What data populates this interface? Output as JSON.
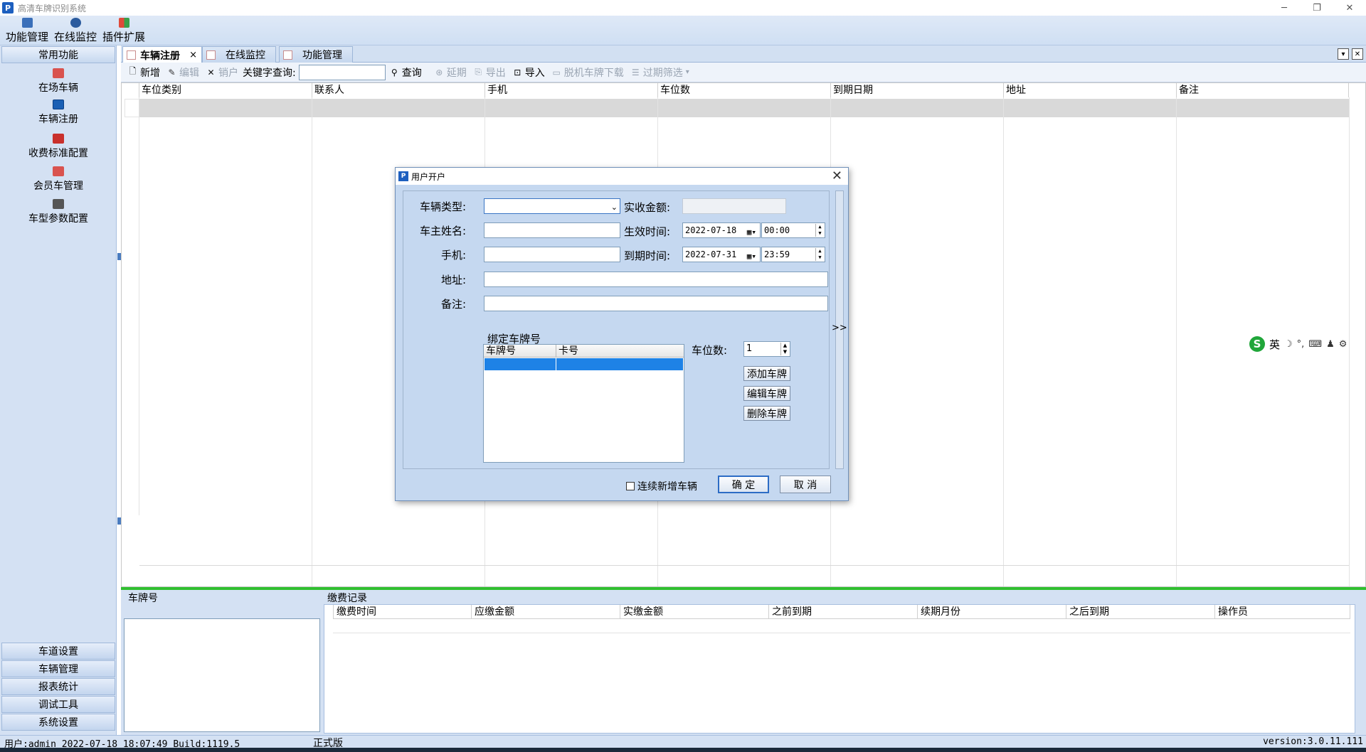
{
  "app": {
    "title": "高清车牌识别系统",
    "logo": "P"
  },
  "window_controls": {
    "minimize": "─",
    "restore": "❐",
    "close": "✕"
  },
  "menubar": [
    {
      "label": "功能管理",
      "icon": "function-icon"
    },
    {
      "label": "在线监控",
      "icon": "monitor-icon"
    },
    {
      "label": "插件扩展",
      "icon": "plugin-icon"
    }
  ],
  "sidebar": {
    "header": "常用功能",
    "items": [
      {
        "label": "在场车辆",
        "icon": "car-icon"
      },
      {
        "label": "车辆注册",
        "icon": "car-register-icon",
        "selected": true
      },
      {
        "label": "收费标准配置",
        "icon": "fee-icon"
      },
      {
        "label": "会员车管理",
        "icon": "member-car-icon"
      },
      {
        "label": "车型参数配置",
        "icon": "vehicle-type-icon"
      }
    ],
    "bottom": [
      "车道设置",
      "车辆管理",
      "报表统计",
      "调试工具",
      "系统设置"
    ]
  },
  "tabs": [
    {
      "label": "车辆注册",
      "active": true,
      "close": "×"
    },
    {
      "label": "在线监控",
      "active": false
    },
    {
      "label": "功能管理",
      "active": false
    }
  ],
  "tab_controls": {
    "dropdown": "▾",
    "close": "✕"
  },
  "toolbar": {
    "new": "新增",
    "edit": "编辑",
    "cancel_account": "销户",
    "keyword_label": "关键字查询:",
    "keyword_value": "",
    "query": "查询",
    "extend": "延期",
    "export": "导出",
    "import": "导入",
    "offline_download": "脱机车牌下载",
    "expiry_filter": "过期筛选",
    "filter_arrow": "▾"
  },
  "grid": {
    "columns": [
      "车位类别",
      "联系人",
      "手机",
      "车位数",
      "到期日期",
      "地址",
      "备注"
    ]
  },
  "lower": {
    "plate_label": "车牌号",
    "payment_label": "缴费记录",
    "payment_columns": [
      "缴费时间",
      "应缴金额",
      "实缴金额",
      "之前到期",
      "续期月份",
      "之后到期",
      "操作员"
    ]
  },
  "statusbar": {
    "user": "用户:admin 2022-07-18 18:07:49 Build:1119.5",
    "edition": "正式版",
    "version": "version:3.0.11.111"
  },
  "ime": {
    "logo": "S",
    "mode": "英",
    "icons": [
      "☽",
      "°,",
      "⌨",
      "♟",
      "⚙"
    ]
  },
  "dialog": {
    "title": "用户开户",
    "close": "✕",
    "vehicle_type_label": "车辆类型:",
    "vehicle_type_value": "",
    "paid_amount_label": "实收金额:",
    "paid_amount_value": "",
    "owner_name_label": "车主姓名:",
    "owner_name_value": "",
    "effective_label": "生效时间:",
    "effective_date": "2022-07-18",
    "effective_time": "00:00",
    "phone_label": "手机:",
    "phone_value": "",
    "expire_label": "到期时间:",
    "expire_date": "2022-07-31",
    "expire_time": "23:59",
    "address_label": "地址:",
    "address_value": "",
    "remark_label": "备注:",
    "remark_value": "",
    "bind_plate_title": "绑定车牌号",
    "plate_columns": [
      "车牌号",
      "卡号"
    ],
    "spaces_label": "车位数:",
    "spaces_value": "1",
    "add_plate": "添加车牌",
    "edit_plate": "编辑车牌",
    "delete_plate": "删除车牌",
    "continuous_label": "连续新增车辆",
    "continuous_checked": false,
    "ok": "确 定",
    "cancel": "取 消",
    "expand": ">>"
  }
}
